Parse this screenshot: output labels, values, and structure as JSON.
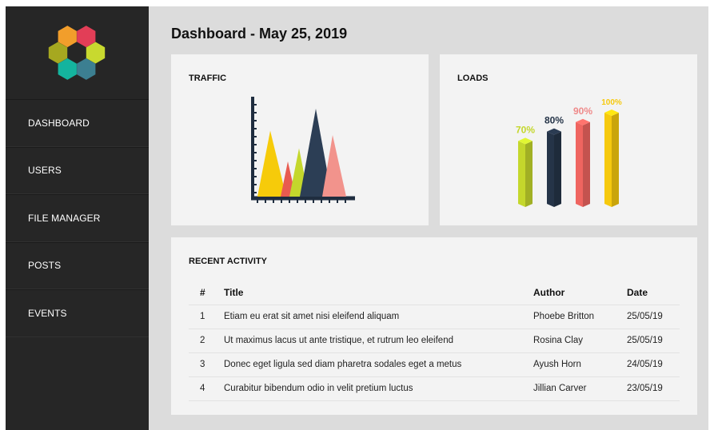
{
  "sidebar": {
    "logo_colors": [
      "#f29e2b",
      "#e23e57",
      "#c8d92f",
      "#3c7f91",
      "#14b49e",
      "#a6a820"
    ],
    "items": [
      {
        "label": "DASHBOARD"
      },
      {
        "label": "USERS"
      },
      {
        "label": "FILE MANAGER"
      },
      {
        "label": "POSTS"
      },
      {
        "label": "EVENTS"
      }
    ]
  },
  "header": {
    "title": "Dashboard - May 25, 2019"
  },
  "traffic": {
    "title": "TRAFFIC",
    "chart_data": {
      "type": "area",
      "series": [
        {
          "color": "#f6cb0a",
          "value": 0.75
        },
        {
          "color": "#e85b50",
          "value": 0.4
        },
        {
          "color": "#c4d72c",
          "value": 0.55
        },
        {
          "color": "#2c3e55",
          "value": 1.0
        },
        {
          "color": "#f2938c",
          "value": 0.7
        }
      ]
    }
  },
  "loads": {
    "title": "LOADS",
    "chart_data": {
      "type": "bar",
      "values": [
        70,
        80,
        90,
        100
      ],
      "labels": [
        "70%",
        "80%",
        "90%",
        "100%"
      ],
      "colors": [
        "#c4d72c",
        "#253448",
        "#ef6560",
        "#f6c90e"
      ],
      "label_colors": [
        "#c4d72c",
        "#253448",
        "#ef8a8a",
        "#f6c90e"
      ]
    }
  },
  "activity": {
    "title": "RECENT ACTIVITY",
    "columns": [
      "#",
      "Title",
      "Author",
      "Date"
    ],
    "rows": [
      {
        "num": "1",
        "title": "Etiam eu erat sit amet nisi eleifend aliquam",
        "author": "Phoebe Britton",
        "date": "25/05/19"
      },
      {
        "num": "2",
        "title": "Ut maximus lacus ut ante tristique, et rutrum leo eleifend",
        "author": "Rosina Clay",
        "date": "25/05/19"
      },
      {
        "num": "3",
        "title": "Donec eget ligula sed diam pharetra sodales eget a metus",
        "author": "Ayush Horn",
        "date": "24/05/19"
      },
      {
        "num": "4",
        "title": "Curabitur bibendum odio in velit pretium luctus",
        "author": "Jillian Carver",
        "date": "23/05/19"
      }
    ]
  }
}
